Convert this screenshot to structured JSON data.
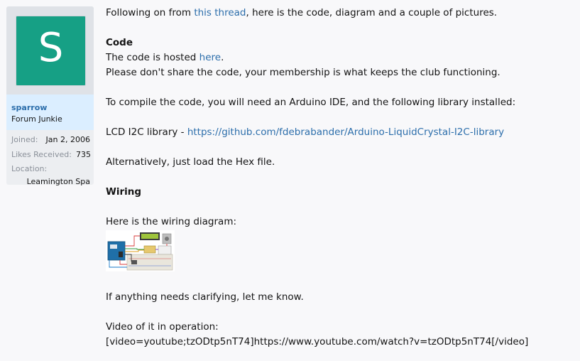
{
  "user": {
    "avatar_letter": "S",
    "username": "sparrow",
    "title": "Forum Junkie",
    "stats": [
      {
        "label": "Joined:",
        "value": "Jan 2, 2006"
      },
      {
        "label": "Likes Received:",
        "value": "735"
      },
      {
        "label": "Location:",
        "value": ""
      }
    ],
    "location_value": "Leamington Spa"
  },
  "post": {
    "intro_prefix": "Following on from ",
    "intro_link": "this thread",
    "intro_suffix": ", here is the code, diagram and a couple of pictures.",
    "code_heading": "Code",
    "hosted_prefix": "The code is hosted ",
    "hosted_link": "here",
    "hosted_suffix": ".",
    "dont_share": "Please don't share the code, your membership is what keeps the club functioning.",
    "compile": "To compile the code, you will need an Arduino IDE, and the following library installed:",
    "lcd_prefix": "LCD I2C library - ",
    "lcd_link": "https://github.com/fdebrabander/Arduino-LiquidCrystal-I2C-library",
    "alternative": "Alternatively, just load the Hex file.",
    "wiring_heading": "Wiring",
    "wiring_intro": "Here is the wiring diagram:",
    "clarify": "If anything needs clarifying, let me know.",
    "video_intro": "Video of it in operation:",
    "video_code": "[video=youtube;tzODtp5nT74]https://www.youtube.com/watch?v=tzODtp5nT74[/video]"
  },
  "colors": {
    "link": "#2c6eab",
    "avatar_bg": "#16a085",
    "name_block_bg": "#dbeeff"
  }
}
